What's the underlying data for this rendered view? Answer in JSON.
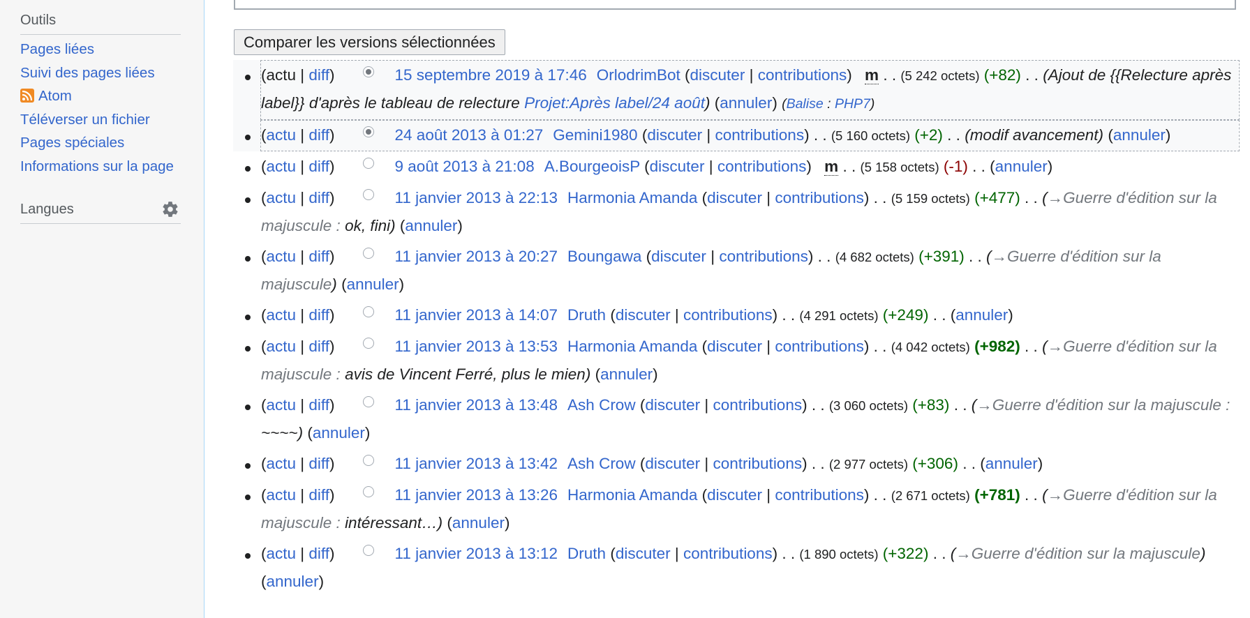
{
  "sidebar": {
    "tools": {
      "heading": "Outils",
      "items": [
        {
          "label": "Pages liées"
        },
        {
          "label": "Suivi des pages liées"
        },
        {
          "label": "Atom"
        },
        {
          "label": "Téléverser un fichier"
        },
        {
          "label": "Pages spéciales"
        },
        {
          "label": "Informations sur la page"
        }
      ]
    },
    "languages": {
      "heading": "Langues"
    }
  },
  "main": {
    "compare_button": "Comparer les versions sélectionnées"
  },
  "labels": {
    "actu": "actu",
    "diff": "diff",
    "discuter": "discuter",
    "contributions": "contributions",
    "annuler": "annuler",
    "minor": "m",
    "dots": ". .",
    "sep": "|"
  },
  "history": [
    {
      "date": "15 septembre 2019 à 17:46",
      "user": "OrlodrimBot",
      "minor": true,
      "size": "(5 242 octets)",
      "change": "(+82)",
      "change_type": "pos",
      "comment_pre": "Ajout de {{Relecture après label}} d'après le tableau de relecture ",
      "comment_link": "Projet:Après label/24 août",
      "tag_label": "Balise",
      "tag_value": "PHP7",
      "radio": "on",
      "actu_link": false,
      "diff_link": true
    },
    {
      "date": "24 août 2013 à 01:27",
      "user": "Gemini1980",
      "size": "(5 160 octets)",
      "change": "(+2)",
      "change_type": "pos",
      "comment": "modif avancement",
      "radio": "on",
      "actu_link": true,
      "diff_link": true
    },
    {
      "date": "9 août 2013 à 21:08",
      "user": "A.BourgeoisP",
      "minor": true,
      "size": "(5 158 octets)",
      "change": "(-1)",
      "change_type": "neg",
      "radio": "off",
      "actu_link": true,
      "diff_link": true
    },
    {
      "date": "11 janvier 2013 à 22:13",
      "user": "Harmonia Amanda",
      "size": "(5 159 octets)",
      "change": "(+477)",
      "change_type": "pos",
      "section": "→Guerre d'édition sur la majuscule :",
      "comment": "ok, fini",
      "radio": "off",
      "actu_link": true,
      "diff_link": true
    },
    {
      "date": "11 janvier 2013 à 20:27",
      "user": "Boungawa",
      "size": "(4 682 octets)",
      "change": "(+391)",
      "change_type": "pos",
      "section": "→Guerre d'édition sur la majuscule",
      "radio": "off",
      "actu_link": true,
      "diff_link": true
    },
    {
      "date": "11 janvier 2013 à 14:07",
      "user": "Druth",
      "size": "(4 291 octets)",
      "change": "(+249)",
      "change_type": "pos",
      "radio": "off",
      "actu_link": true,
      "diff_link": true
    },
    {
      "date": "11 janvier 2013 à 13:53",
      "user": "Harmonia Amanda",
      "size": "(4 042 octets)",
      "change": "(+982)",
      "change_type": "pos-big",
      "section": "→Guerre d'édition sur la majuscule :",
      "comment": "avis de Vincent Ferré, plus le mien",
      "radio": "off",
      "actu_link": true,
      "diff_link": true
    },
    {
      "date": "11 janvier 2013 à 13:48",
      "user": "Ash Crow",
      "size": "(3 060 octets)",
      "change": "(+83)",
      "change_type": "pos",
      "section": "→Guerre d'édition sur la majuscule :",
      "comment": "~~~~",
      "radio": "off",
      "actu_link": true,
      "diff_link": true
    },
    {
      "date": "11 janvier 2013 à 13:42",
      "user": "Ash Crow",
      "size": "(2 977 octets)",
      "change": "(+306)",
      "change_type": "pos",
      "radio": "off",
      "actu_link": true,
      "diff_link": true
    },
    {
      "date": "11 janvier 2013 à 13:26",
      "user": "Harmonia Amanda",
      "size": "(2 671 octets)",
      "change": "(+781)",
      "change_type": "pos-big",
      "section": "→Guerre d'édition sur la majuscule :",
      "comment": "intéressant…",
      "radio": "off",
      "actu_link": true,
      "diff_link": true
    },
    {
      "date": "11 janvier 2013 à 13:12",
      "user": "Druth",
      "size": "(1 890 octets)",
      "change": "(+322)",
      "change_type": "pos",
      "section": "→Guerre d'édition sur la majuscule",
      "radio": "off",
      "actu_link": true,
      "diff_link": true
    }
  ]
}
